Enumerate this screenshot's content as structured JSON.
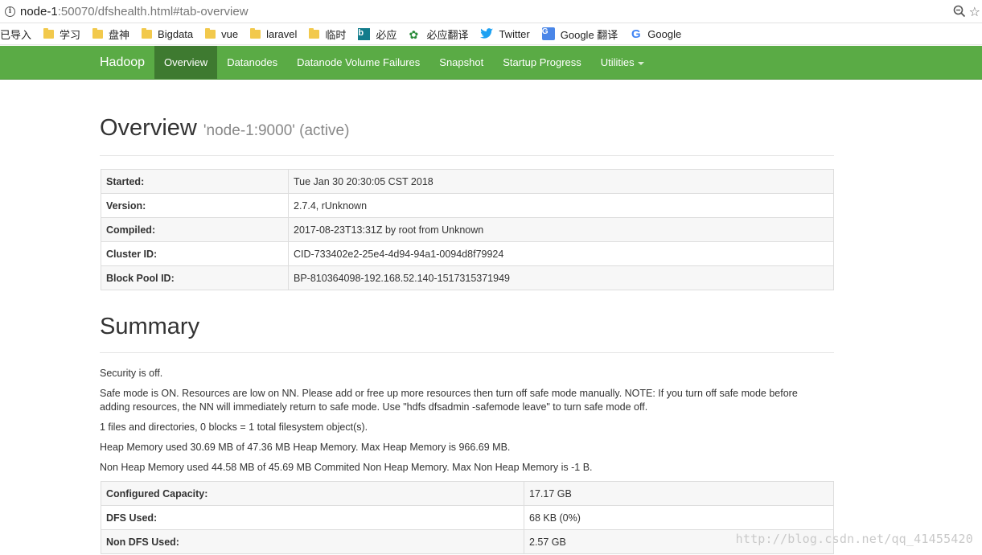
{
  "browser": {
    "url_host": "node-1",
    "url_rest": ":50070/dfshealth.html#tab-overview",
    "bookmarks": [
      {
        "label": "已导入",
        "icon": "none"
      },
      {
        "label": "学习",
        "icon": "folder-icon"
      },
      {
        "label": "盘神",
        "icon": "folder-icon"
      },
      {
        "label": "Bigdata",
        "icon": "folder-icon"
      },
      {
        "label": "vue",
        "icon": "folder-icon"
      },
      {
        "label": "laravel",
        "icon": "folder-icon"
      },
      {
        "label": "临时",
        "icon": "folder-icon"
      },
      {
        "label": "必应",
        "icon": "bing-icon"
      },
      {
        "label": "必应翻译",
        "icon": "translate-icon"
      },
      {
        "label": "Twitter",
        "icon": "twitter-icon"
      },
      {
        "label": "Google 翻译",
        "icon": "google-translate-icon"
      },
      {
        "label": "Google",
        "icon": "google-icon"
      }
    ]
  },
  "navbar": {
    "brand": "Hadoop",
    "items": [
      {
        "label": "Overview",
        "active": true
      },
      {
        "label": "Datanodes",
        "active": false
      },
      {
        "label": "Datanode Volume Failures",
        "active": false
      },
      {
        "label": "Snapshot",
        "active": false
      },
      {
        "label": "Startup Progress",
        "active": false
      },
      {
        "label": "Utilities",
        "active": false
      }
    ],
    "accent_color": "#5aab45"
  },
  "overview": {
    "title": "Overview",
    "subtitle": "'node-1:9000' (active)",
    "rows": [
      {
        "key": "Started:",
        "value": "Tue Jan 30 20:30:05 CST 2018"
      },
      {
        "key": "Version:",
        "value": "2.7.4, rUnknown"
      },
      {
        "key": "Compiled:",
        "value": "2017-08-23T13:31Z by root from Unknown"
      },
      {
        "key": "Cluster ID:",
        "value": "CID-733402e2-25e4-4d94-94a1-0094d8f79924"
      },
      {
        "key": "Block Pool ID:",
        "value": "BP-810364098-192.168.52.140-1517315371949"
      }
    ]
  },
  "summary": {
    "title": "Summary",
    "security": "Security is off.",
    "safemode_line1": "Safe mode is ON. Resources are low on NN. Please add or free up more resources then turn off safe mode manually. NOTE: If you turn off safe mode before",
    "safemode_line2": "adding resources, the NN will immediately return to safe mode. Use \"hdfs dfsadmin -safemode leave\" to turn safe mode off.",
    "files": "1 files and directories, 0 blocks = 1 total filesystem object(s).",
    "heap": "Heap Memory used 30.69 MB of 47.36 MB Heap Memory. Max Heap Memory is 966.69 MB.",
    "nonheap": "Non Heap Memory used 44.58 MB of 45.69 MB Commited Non Heap Memory. Max Non Heap Memory is -1 B.",
    "rows": [
      {
        "key": "Configured Capacity:",
        "value": "17.17 GB"
      },
      {
        "key": "DFS Used:",
        "value": "68 KB (0%)"
      },
      {
        "key": "Non DFS Used:",
        "value": "2.57 GB"
      }
    ]
  },
  "watermark": "http://blog.csdn.net/qq_41455420"
}
